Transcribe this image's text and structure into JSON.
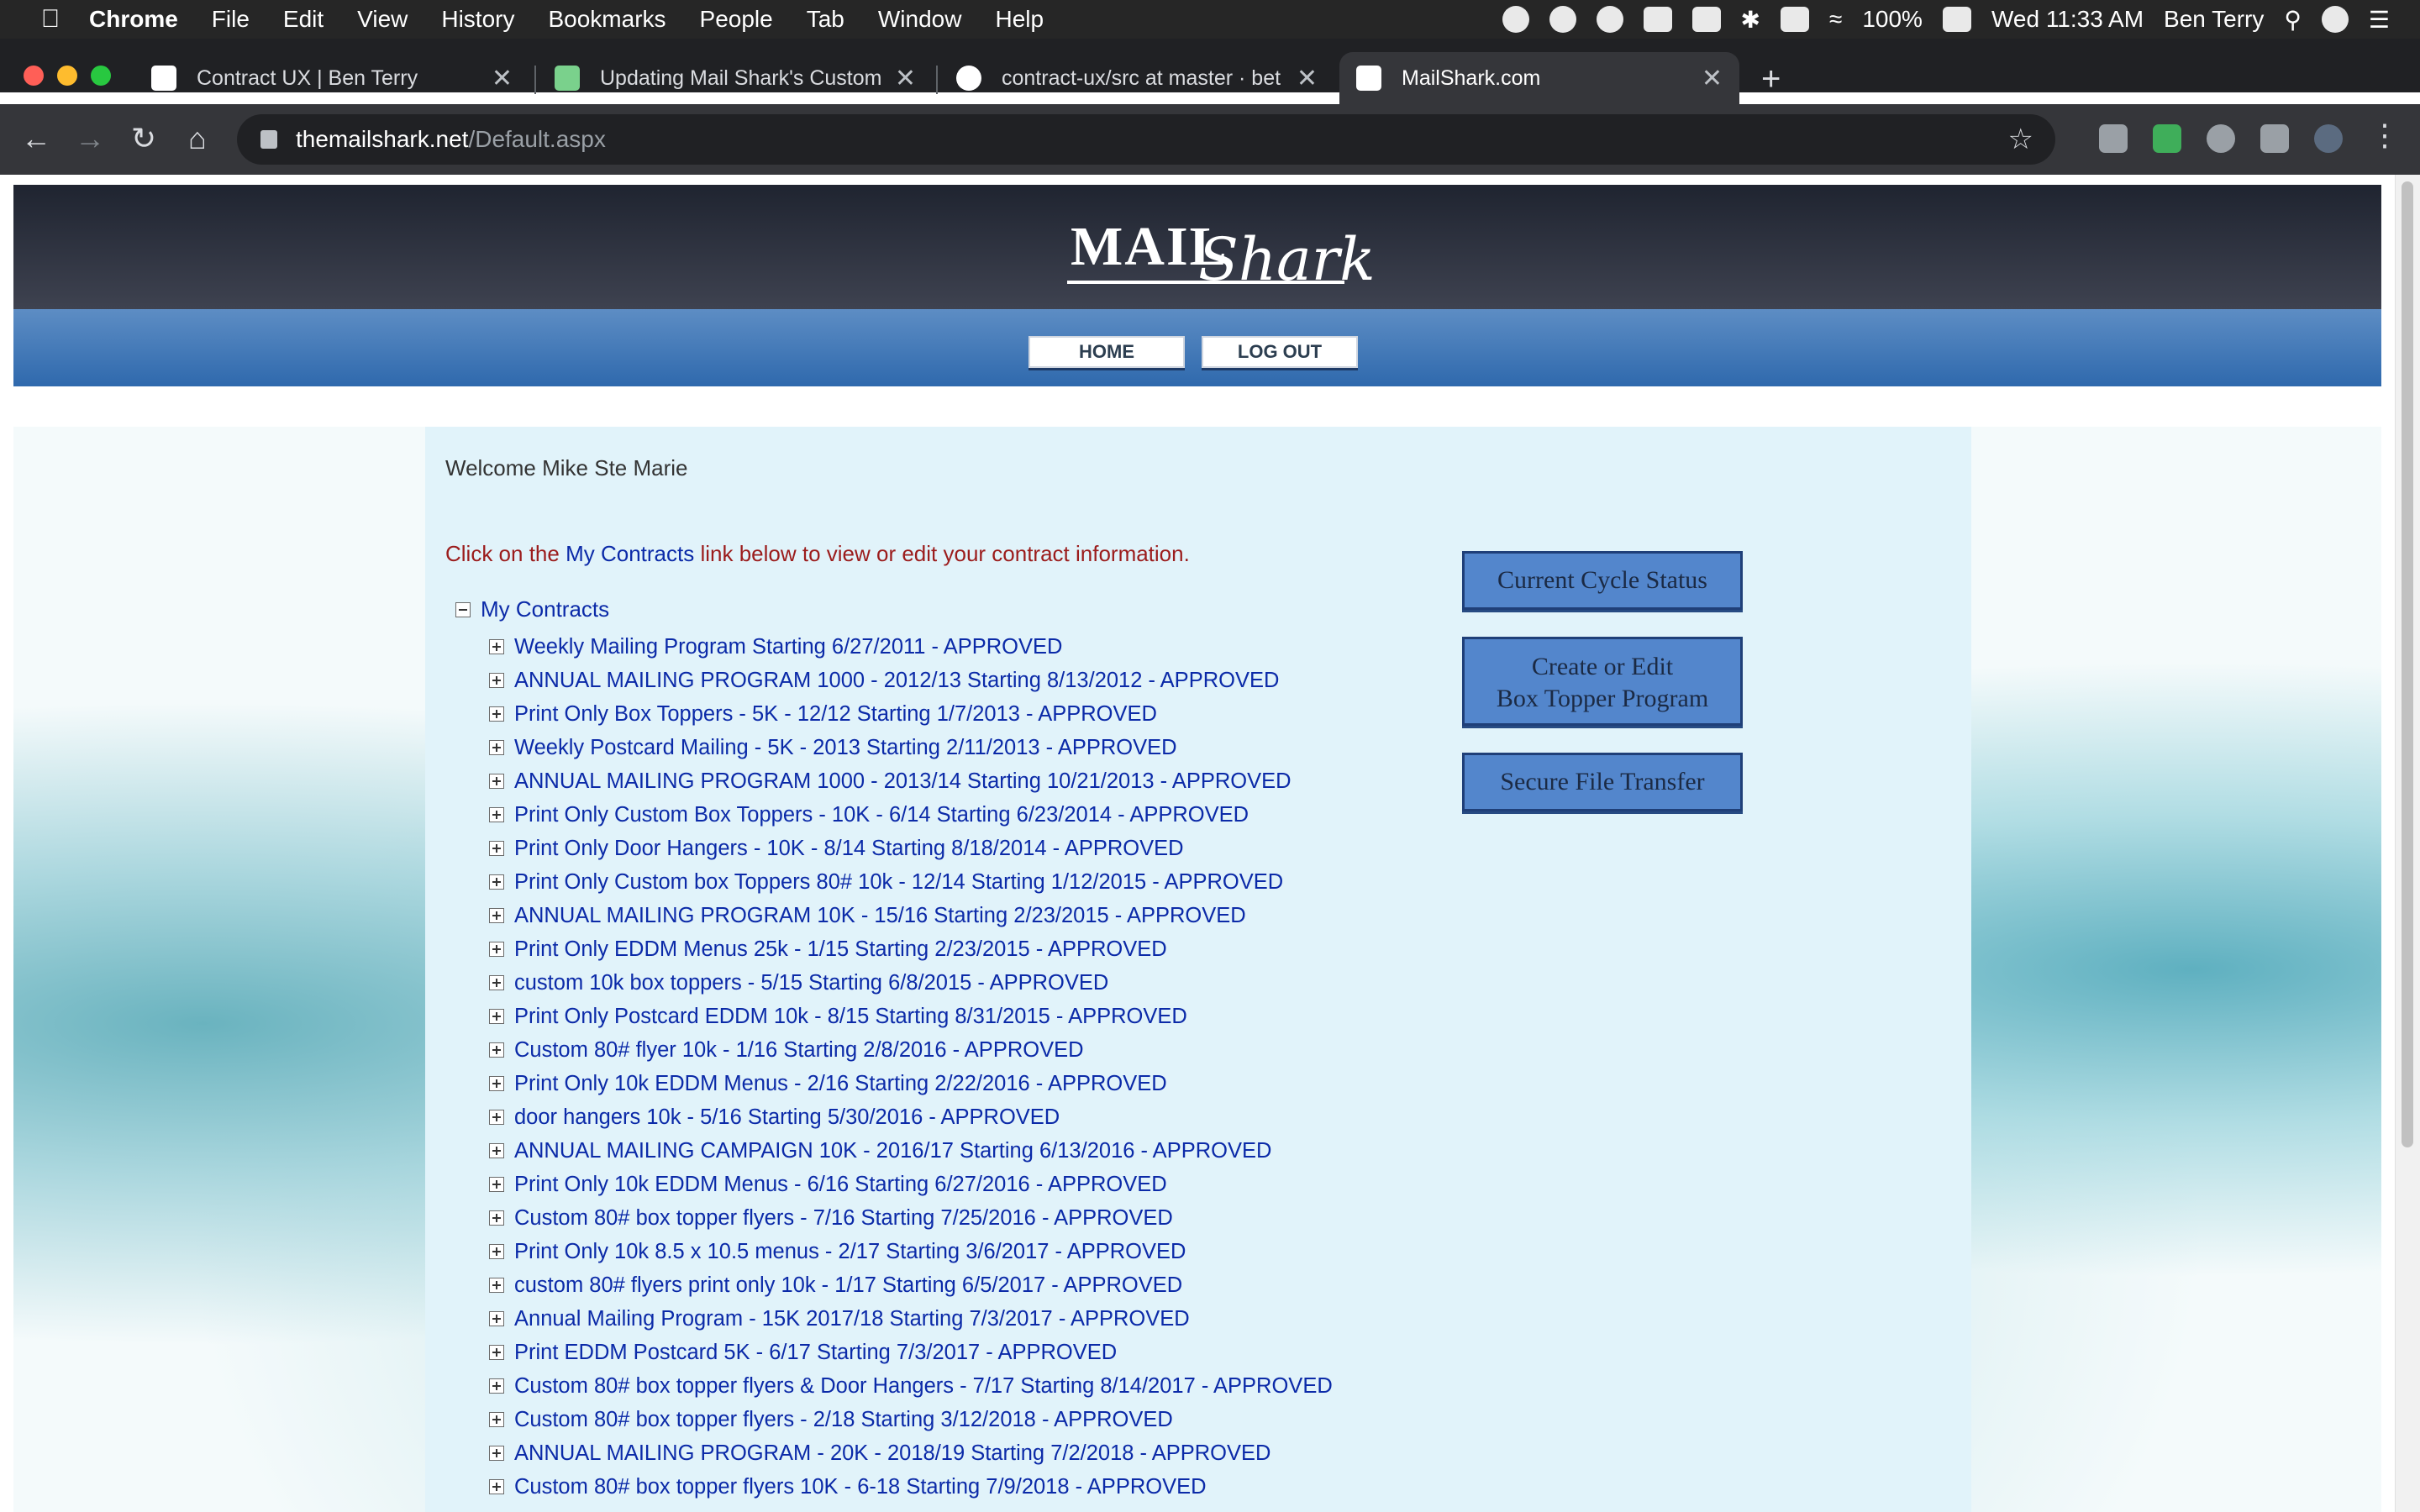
{
  "menubar": {
    "app": "Chrome",
    "items": [
      "File",
      "Edit",
      "View",
      "History",
      "Bookmarks",
      "People",
      "Tab",
      "Window",
      "Help"
    ],
    "battery": "100%",
    "clock": "Wed 11:33 AM",
    "user": "Ben Terry"
  },
  "browser": {
    "tabs": [
      {
        "title": "Contract UX | Ben Terry"
      },
      {
        "title": "Updating Mail Shark's Custome"
      },
      {
        "title": "contract-ux/src at master · bet"
      },
      {
        "title": "MailShark.com"
      }
    ],
    "url_host": "themailshark.net",
    "url_path": "/Default.aspx"
  },
  "site": {
    "logo": {
      "word": "MAIL",
      "script": "Shark"
    },
    "nav": {
      "home": "HOME",
      "logout": "LOG OUT"
    },
    "welcome": "Welcome Mike Ste Marie",
    "instruction": {
      "before": "Click on the ",
      "link": "My Contracts",
      "after": " link below to view or edit your contract information."
    },
    "tree_root": "My Contracts",
    "contracts": [
      "Weekly Mailing Program Starting 6/27/2011 - APPROVED",
      "ANNUAL MAILING PROGRAM 1000 - 2012/13 Starting 8/13/2012 - APPROVED",
      "Print Only Box Toppers - 5K - 12/12 Starting 1/7/2013 - APPROVED",
      "Weekly Postcard Mailing - 5K - 2013 Starting 2/11/2013 - APPROVED",
      "ANNUAL MAILING PROGRAM 1000 - 2013/14 Starting 10/21/2013 - APPROVED",
      "Print Only Custom Box Toppers - 10K - 6/14 Starting 6/23/2014 - APPROVED",
      "Print Only Door Hangers - 10K - 8/14 Starting 8/18/2014 - APPROVED",
      "Print Only Custom box Toppers 80# 10k - 12/14 Starting 1/12/2015 - APPROVED",
      "ANNUAL MAILING PROGRAM 10K - 15/16 Starting 2/23/2015 - APPROVED",
      "Print Only EDDM Menus 25k - 1/15 Starting 2/23/2015 - APPROVED",
      "custom 10k box toppers - 5/15 Starting 6/8/2015 - APPROVED",
      "Print Only Postcard EDDM 10k - 8/15 Starting 8/31/2015 - APPROVED",
      "Custom 80# flyer 10k - 1/16 Starting 2/8/2016 - APPROVED",
      "Print Only 10k EDDM Menus - 2/16 Starting 2/22/2016 - APPROVED",
      "door hangers 10k - 5/16 Starting 5/30/2016 - APPROVED",
      "ANNUAL MAILING CAMPAIGN 10K - 2016/17 Starting 6/13/2016 - APPROVED",
      "Print Only 10k EDDM Menus - 6/16 Starting 6/27/2016 - APPROVED",
      "Custom 80# box topper flyers - 7/16 Starting 7/25/2016 - APPROVED",
      "Print Only 10k 8.5 x 10.5 menus - 2/17 Starting 3/6/2017 - APPROVED",
      "custom 80# flyers print only 10k - 1/17 Starting 6/5/2017 - APPROVED",
      "Annual Mailing Program - 15K 2017/18 Starting 7/3/2017 - APPROVED",
      "Print EDDM Postcard 5K - 6/17 Starting 7/3/2017 - APPROVED",
      "Custom 80# box topper flyers & Door Hangers - 7/17 Starting 8/14/2017 - APPROVED",
      "Custom 80# box topper flyers - 2/18 Starting 3/12/2018 - APPROVED",
      "ANNUAL MAILING PROGRAM - 20K - 2018/19 Starting 7/2/2018 - APPROVED",
      "Custom 80# box topper flyers 10K - 6-18 Starting 7/9/2018 - APPROVED"
    ],
    "buttons": {
      "cycle": "Current Cycle Status",
      "box_topper_line1": "Create or Edit",
      "box_topper_line2": "Box Topper Program",
      "file_transfer": "Secure File Transfer"
    }
  }
}
